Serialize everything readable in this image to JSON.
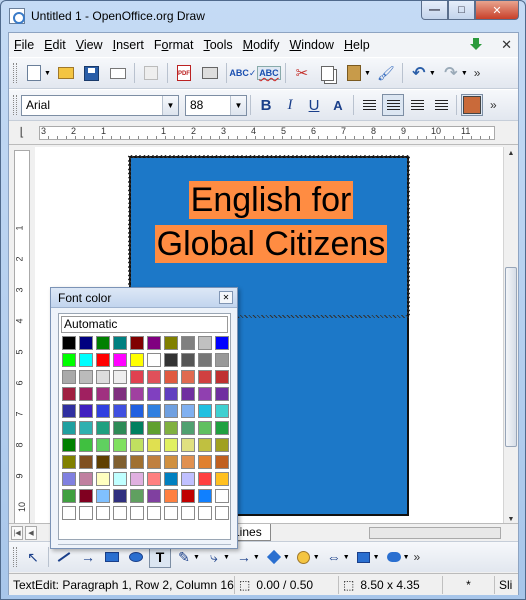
{
  "window": {
    "title": "Untitled 1 - OpenOffice.org Draw"
  },
  "caption_buttons": {
    "minimize": "—",
    "maximize": "□",
    "close": "✕"
  },
  "menu": [
    {
      "pre": "",
      "u": "F",
      "post": "ile"
    },
    {
      "pre": "",
      "u": "E",
      "post": "dit"
    },
    {
      "pre": "",
      "u": "V",
      "post": "iew"
    },
    {
      "pre": "",
      "u": "I",
      "post": "nsert"
    },
    {
      "pre": "F",
      "u": "o",
      "post": "rmat"
    },
    {
      "pre": "",
      "u": "T",
      "post": "ools"
    },
    {
      "pre": "",
      "u": "M",
      "post": "odify"
    },
    {
      "pre": "",
      "u": "W",
      "post": "indow"
    },
    {
      "pre": "",
      "u": "H",
      "post": "elp"
    }
  ],
  "formatting": {
    "font_name": "Arial",
    "font_size": "88",
    "bold": "B",
    "italic": "I",
    "underline": "U",
    "fontwork": "A"
  },
  "ruler": {
    "h_numbers": [
      "3",
      "2",
      "1",
      "",
      "1",
      "2",
      "3",
      "4",
      "5",
      "6",
      "7",
      "8",
      "9",
      "10",
      "11"
    ],
    "v_numbers": [
      "1",
      "2",
      "3",
      "4",
      "5",
      "6",
      "7",
      "8",
      "9",
      "10"
    ]
  },
  "slide": {
    "line1": "English for",
    "line2": "Global Citizens"
  },
  "layer_tab": "Dimension Lines",
  "layer_tab_visible": "n Lines",
  "status": {
    "mode": "TextEdit: Paragraph 1, Row 2, Column 16",
    "position": "0.00 / 0.50",
    "size": "8.50 x 4.35",
    "modified": "*",
    "slide_label": "Sli"
  },
  "font_color_panel": {
    "title": "Font color",
    "automatic_label": "Automatic",
    "colors": [
      "#000000",
      "#000080",
      "#008000",
      "#008080",
      "#800000",
      "#800080",
      "#808000",
      "#808080",
      "#c0c0c0",
      "#0000ff",
      "#00ff00",
      "#00ffff",
      "#ff0000",
      "#ff00ff",
      "#ffff00",
      "#ffffff",
      "#333333",
      "#555555",
      "#777777",
      "#999999",
      "#aaaaaa",
      "#bbbbbb",
      "#dddddd",
      "#eeeeee",
      "#e04050",
      "#e0505a",
      "#e05a40",
      "#e06a50",
      "#d04040",
      "#c03030",
      "#a02040",
      "#a02060",
      "#a03080",
      "#803080",
      "#a040a0",
      "#8040c0",
      "#6040c0",
      "#7030a0",
      "#9040b0",
      "#7030a0",
      "#3030a0",
      "#4020c0",
      "#3040e0",
      "#4050e0",
      "#2060e0",
      "#3080e0",
      "#70a0e0",
      "#80b0f0",
      "#20c0e0",
      "#40d0d0",
      "#20a0a0",
      "#30b0b0",
      "#20a080",
      "#2e8b57",
      "#008060",
      "#60a030",
      "#80b040",
      "#50a070",
      "#60c060",
      "#20a040",
      "#008000",
      "#40c040",
      "#60d060",
      "#80e060",
      "#c0e060",
      "#e0e050",
      "#e0f060",
      "#e0e080",
      "#c0c040",
      "#a0a020",
      "#808000",
      "#805020",
      "#604000",
      "#806030",
      "#a07030",
      "#c08040",
      "#d09040",
      "#e09050",
      "#e08030",
      "#c06020",
      "#8080e0",
      "#c080a0",
      "#ffffc0",
      "#c0ffff",
      "#e0b0e0",
      "#ff8080",
      "#0080c0",
      "#c0c0ff",
      "#ff4040",
      "#ffc020",
      "#40a040",
      "#800020",
      "#80c0ff",
      "#303080",
      "#60a060",
      "#8040a0",
      "#ff8040",
      "#c00000",
      "#1080ff",
      "#ffffff",
      "#ffffff",
      "#ffffff",
      "#ffffff",
      "#ffffff",
      "#ffffff",
      "#ffffff",
      "#ffffff",
      "#ffffff",
      "#ffffff",
      "#ffffff"
    ]
  }
}
